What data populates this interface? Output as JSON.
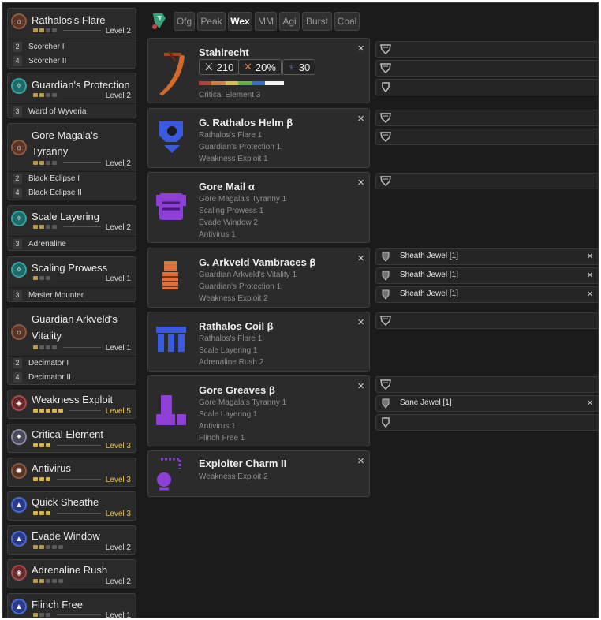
{
  "skills": [
    {
      "name": "Rathalos's Flare",
      "level": "Level 2",
      "subs": [
        {
          "n": "2",
          "t": "Scorcher I"
        },
        {
          "n": "4",
          "t": "Scorcher II"
        }
      ]
    },
    {
      "name": "Guardian's Protection",
      "level": "Level 2",
      "subs": [
        {
          "n": "3",
          "t": "Ward of Wyveria"
        }
      ]
    },
    {
      "name_line1": "Gore Magala's",
      "name_line2": "Tyranny",
      "level": "Level 2",
      "subs": [
        {
          "n": "2",
          "t": "Black Eclipse I"
        },
        {
          "n": "4",
          "t": "Black Eclipse II"
        }
      ]
    },
    {
      "name": "Scale Layering",
      "level": "Level 2",
      "subs": [
        {
          "n": "3",
          "t": "Adrenaline"
        }
      ]
    },
    {
      "name": "Scaling Prowess",
      "level": "Level 1",
      "subs": [
        {
          "n": "3",
          "t": "Master Mounter"
        }
      ]
    },
    {
      "name_line1": "Guardian Arkveld's",
      "name_line2": "Vitality",
      "level": "Level 1",
      "subs": [
        {
          "n": "2",
          "t": "Decimator I"
        },
        {
          "n": "4",
          "t": "Decimator II"
        }
      ]
    },
    {
      "name": "Weakness Exploit",
      "level": "Level 5"
    },
    {
      "name": "Critical Element",
      "level": "Level 3"
    },
    {
      "name": "Antivirus",
      "level": "Level 3"
    },
    {
      "name": "Quick Sheathe",
      "level": "Level 3"
    },
    {
      "name": "Evade Window",
      "level": "Level 2"
    },
    {
      "name": "Adrenaline Rush",
      "level": "Level 2"
    },
    {
      "name": "Flinch Free",
      "level": "Level 1"
    }
  ],
  "filters": [
    "Ofg",
    "Peak",
    "Wex",
    "MM",
    "Agi",
    "Burst",
    "Coal"
  ],
  "active_filter": "Wex",
  "weapon": {
    "name": "Stahlrecht",
    "attack": "210",
    "affinity": "20%",
    "element": "30",
    "skills": [
      "Critical Element 3"
    ]
  },
  "armor": [
    {
      "name": "G. Rathalos Helm β",
      "skills": [
        "Rathalos's Flare 1",
        "Guardian's Protection 1",
        "Weakness Exploit 1"
      ]
    },
    {
      "name": "Gore Mail α",
      "skills": [
        "Gore Magala's Tyranny 1",
        "Scaling Prowess 1",
        "Evade Window 2",
        "Antivirus 1"
      ]
    },
    {
      "name": "G. Arkveld Vambraces β",
      "skills": [
        "Guardian Arkveld's Vitality 1",
        "Guardian's Protection 1",
        "Weakness Exploit 2"
      ]
    },
    {
      "name": "Rathalos Coil β",
      "skills": [
        "Rathalos's Flare 1",
        "Scale Layering 1",
        "Adrenaline Rush 2"
      ]
    },
    {
      "name": "Gore Greaves β",
      "skills": [
        "Gore Magala's Tyranny 1",
        "Scale Layering 1",
        "Antivirus 1",
        "Flinch Free 1"
      ]
    },
    {
      "name": "Exploiter Charm II",
      "skills": [
        "Weakness Exploit 2"
      ]
    }
  ],
  "jewels": {
    "sheath": "Sheath Jewel [1]",
    "sane": "Sane Jewel [1]"
  },
  "icons": {
    "close": "×",
    "wyvern_slot": "wyvern-slot-icon"
  },
  "colors": {
    "gold": "#e8c24a",
    "purple": "#8e3fd6",
    "blue": "#3f6fe6",
    "orange": "#e0703a"
  }
}
